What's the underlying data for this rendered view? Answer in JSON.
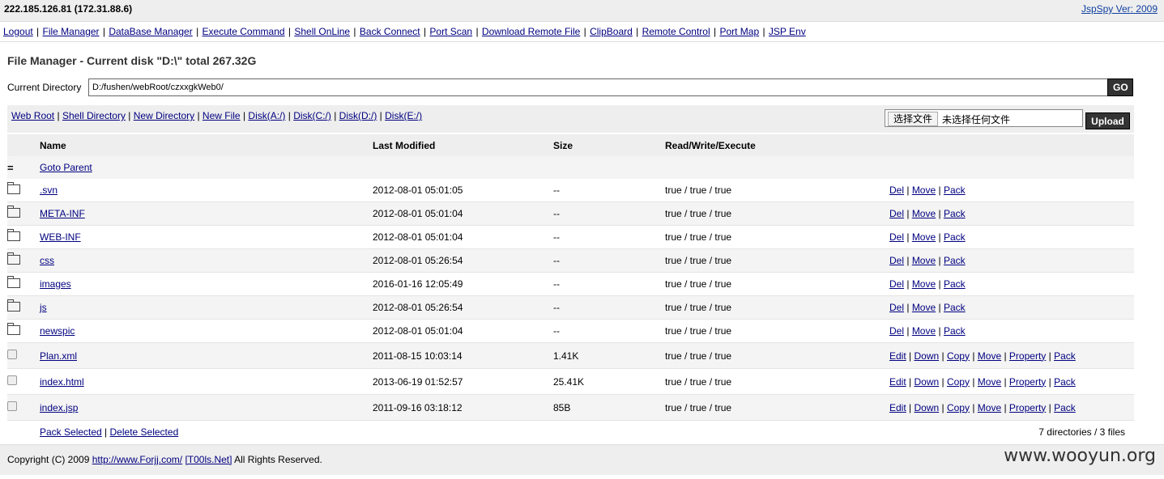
{
  "topbar": {
    "ip": "222.185.126.81 (172.31.88.6)",
    "version": "JspSpy Ver: 2009"
  },
  "menu": [
    "Logout",
    "File Manager",
    "DataBase Manager",
    "Execute Command",
    "Shell OnLine",
    "Back Connect",
    "Port Scan",
    "Download Remote File",
    "ClipBoard",
    "Remote Control",
    "Port Map",
    "JSP Env"
  ],
  "title": "File Manager - Current disk \"D:\\\" total 267.32G",
  "current_dir": {
    "label": "Current Directory",
    "value": "D:/fushen/webRoot/czxxgkWeb0/",
    "go": "GO"
  },
  "tools": {
    "links": [
      "Web Root",
      "Shell Directory",
      "New Directory",
      "New File",
      "Disk(A:/)",
      "Disk(C:/)",
      "Disk(D:/)",
      "Disk(E:/)"
    ],
    "choose_file": "选择文件",
    "no_file": "未选择任何文件",
    "upload": "Upload"
  },
  "table": {
    "headers": [
      "Name",
      "Last Modified",
      "Size",
      "Read/Write/Execute"
    ],
    "parent": "Goto Parent",
    "dirs": [
      {
        "name": ".svn",
        "modified": "2012-08-01 05:01:05",
        "size": "--",
        "rwx": "true / true / true"
      },
      {
        "name": "META-INF",
        "modified": "2012-08-01 05:01:04",
        "size": "--",
        "rwx": "true / true / true"
      },
      {
        "name": "WEB-INF",
        "modified": "2012-08-01 05:01:04",
        "size": "--",
        "rwx": "true / true / true"
      },
      {
        "name": "css",
        "modified": "2012-08-01 05:26:54",
        "size": "--",
        "rwx": "true / true / true"
      },
      {
        "name": "images",
        "modified": "2016-01-16 12:05:49",
        "size": "--",
        "rwx": "true / true / true"
      },
      {
        "name": "js",
        "modified": "2012-08-01 05:26:54",
        "size": "--",
        "rwx": "true / true / true"
      },
      {
        "name": "newspic",
        "modified": "2012-08-01 05:01:04",
        "size": "--",
        "rwx": "true / true / true"
      }
    ],
    "dir_actions": [
      "Del",
      "Move",
      "Pack"
    ],
    "files": [
      {
        "name": "Plan.xml",
        "modified": "2011-08-15 10:03:14",
        "size": "1.41K",
        "rwx": "true / true / true"
      },
      {
        "name": "index.html",
        "modified": "2013-06-19 01:52:57",
        "size": "25.41K",
        "rwx": "true / true / true"
      },
      {
        "name": "index.jsp",
        "modified": "2011-09-16 03:18:12",
        "size": "85B",
        "rwx": "true / true / true"
      }
    ],
    "file_actions": [
      "Edit",
      "Down",
      "Copy",
      "Move",
      "Property",
      "Pack"
    ],
    "pack_selected": "Pack Selected",
    "delete_selected": "Delete Selected",
    "summary": "7 directories / 3 files"
  },
  "footer": {
    "copyright": "Copyright (C) 2009",
    "link1": "http://www.Forjj.com/",
    "link2": "[T00ls.Net]",
    "rights": "All Rights Reserved.",
    "watermark": "www.wooyun.org"
  }
}
